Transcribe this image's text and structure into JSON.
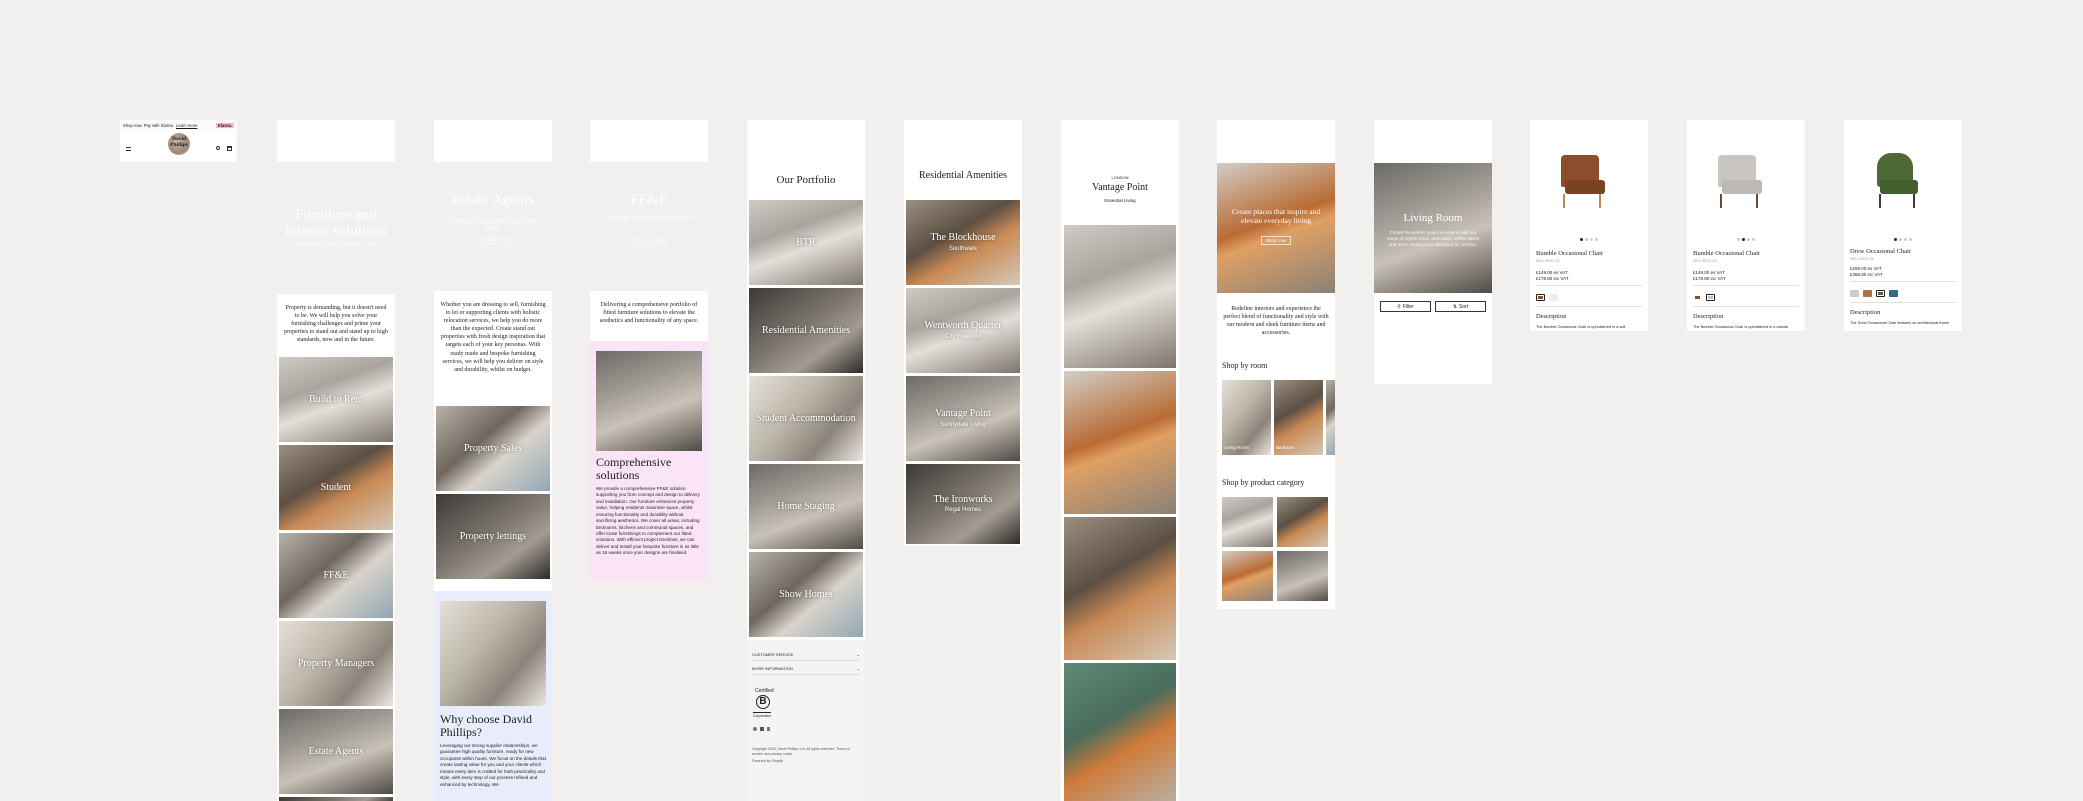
{
  "colors": {
    "background": "#f2f0ee",
    "klarna_pink": "#ffb3c7",
    "ffe_panel": "#fbe4f7",
    "why_panel": "#e9ecfa"
  },
  "header": {
    "announcement": "Shop now. Pay with Klarna.",
    "announcement_link": "Learn more",
    "klarna": "Klarna.",
    "logo": "David Phillips",
    "icons": [
      "menu-icon",
      "search-icon",
      "cart-icon"
    ]
  },
  "furniture": {
    "title": "Furniture and interior solutions",
    "subtitle": "Designed for life, tailored to you",
    "intro": "Property is demanding, but it doesn't need to be. We will help you solve your furnishing challenges and prime your properties to stand out and stand up to high standards, now and in the future.",
    "tiles": [
      "Build to Rent",
      "Student",
      "FF&E",
      "Property Managers",
      "Estate Agents"
    ]
  },
  "estate": {
    "title": "Estate Agents",
    "subtitle": "Furniture design that sells homes faster",
    "cta": "Find out more",
    "intro": "Whether you are dressing to sell, furnishing to let or supporting clients with holistic relocation services, we help you do more than the expected. Create stand out properties with fresh design inspiration that targets each of your key personas. With ready made and bespoke furnishing services, we will help you deliver on style and durability, whilst on budget.",
    "tiles": [
      "Property Sales",
      "Property lettings"
    ],
    "why_title": "Why choose David Phillips?",
    "why_text": "Leveraging our strong supplier relationships, we guarantee high quality furniture, ready for new occupants within hours. We focus on the details that create lasting value for you and your clients which means every item is crafted for both practicality and style, with every step of our process refined and enhanced by technology. We"
  },
  "ffe": {
    "title": "FF&E",
    "subtitle": "Furniture, fixtures and equipment",
    "cta": "Find out more",
    "intro": "Delivering a comprehensive portfolio of fitted furniture solutions to elevate the aesthetics and functionality of any space.",
    "panel_title": "Comprehensive solutions",
    "panel_text": "We provide a comprehensive FF&E solution supporting you from concept and design to delivery and installation. Our furniture enhances property value, helping residents maximise space, whilst ensuring functionality and durability without sacrificing aesthetics. We cover all areas, including bedrooms, kitchens and communal spaces, and offer loose furnishings to complement our fitted solutions. With efficient project timelines, we can deliver and install your bespoke furniture in as little as 16 weeks once your designs are finalised."
  },
  "portfolio": {
    "title": "Our Portfolio",
    "tiles": [
      "BTR",
      "Residential Amenities",
      "Student Accommodation",
      "Home Staging",
      "Show Homes"
    ],
    "accordions": [
      "CUSTOMER SERVICE",
      "MORE INFORMATION"
    ],
    "certified": "Certified",
    "b_letter": "B",
    "corporation": "Corporation",
    "copyright": "Copyright 2025, David Phillips Ltd. All rights reserved. Terms of service and privacy notice",
    "powered": "Powered by Shopify"
  },
  "amenities": {
    "title": "Residential Amenities",
    "tiles": [
      {
        "name": "The Blockhouse",
        "sub": "Southwark"
      },
      {
        "name": "Wentworth Quarter",
        "sub": "City Freehold"
      },
      {
        "name": "Vantage Point",
        "sub": "Sunnydale Living"
      },
      {
        "name": "The Ironworks",
        "sub": "Regal Homes"
      }
    ]
  },
  "vantage": {
    "eyebrow": "LONDON",
    "title": "Vantage Point",
    "subtitle": "Essential Living"
  },
  "shop": {
    "hero_title": "Create places that inspire and elevate everyday living",
    "hero_cta": "Shop now",
    "intro": "Redefine interiors and experience the perfect blend of functionality and style with our modern and sleek furniture items and accessories.",
    "by_room": "Shop by room",
    "rooms": [
      "Living Room",
      "Bedroom"
    ],
    "by_category": "Shop by product category"
  },
  "living": {
    "title": "Living Room",
    "text": "Create the perfect space to unwind with our range of stylish sofas, armchairs, coffee tables and more. Every piece designed for comfort.",
    "filter": "Filter",
    "sort": "Sort"
  },
  "products": [
    {
      "name": "Bumble Occasional Chair",
      "sku": "SKU: BOC-01",
      "price_ex": "£149.00 ex VAT",
      "price_inc": "£178.80 inc VAT",
      "description": "Description",
      "desc_text": "The Bumble Occasional Chair is upholstered in a soft"
    },
    {
      "name": "Bumble Occasional Chair",
      "sku": "SKU: BOC-02",
      "price_ex": "£149.00 ex VAT",
      "price_inc": "£178.80 inc VAT",
      "description": "Description",
      "desc_text": "The Bumble Occasional Chair is upholstered in a natural"
    },
    {
      "name": "Drew Occasional Chair",
      "sku": "SKU: DOC-01",
      "price_ex": "£299.00 ex VAT",
      "price_inc": "£358.80 inc VAT",
      "description": "Description",
      "desc_text": "The Drew Occasional Chair features an architectural frame"
    }
  ]
}
